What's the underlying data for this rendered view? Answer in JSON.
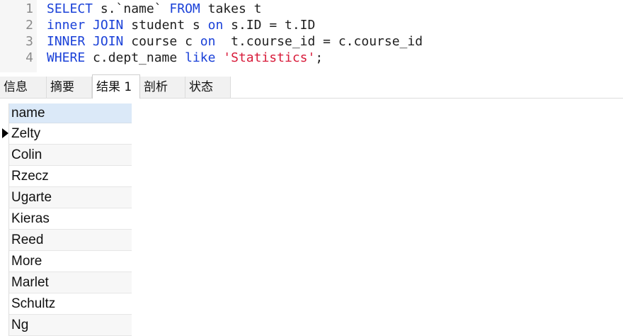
{
  "editor": {
    "lines": [
      {
        "num": "1",
        "tokens": [
          {
            "t": "SELECT",
            "k": "kw"
          },
          {
            "t": " s.`name` ",
            "k": ""
          },
          {
            "t": "FROM",
            "k": "kw"
          },
          {
            "t": " takes t",
            "k": ""
          }
        ]
      },
      {
        "num": "2",
        "tokens": [
          {
            "t": "inner",
            "k": "kw"
          },
          {
            "t": " ",
            "k": ""
          },
          {
            "t": "JOIN",
            "k": "kw"
          },
          {
            "t": " student s ",
            "k": ""
          },
          {
            "t": "on",
            "k": "kw"
          },
          {
            "t": " s.ID = t.ID",
            "k": ""
          }
        ]
      },
      {
        "num": "3",
        "tokens": [
          {
            "t": "INNER",
            "k": "kw"
          },
          {
            "t": " ",
            "k": ""
          },
          {
            "t": "JOIN",
            "k": "kw"
          },
          {
            "t": " course c ",
            "k": ""
          },
          {
            "t": "on",
            "k": "kw"
          },
          {
            "t": "  t.course_id = c.course_id",
            "k": ""
          }
        ]
      },
      {
        "num": "4",
        "tokens": [
          {
            "t": "WHERE",
            "k": "kw"
          },
          {
            "t": " c.dept_name ",
            "k": ""
          },
          {
            "t": "like",
            "k": "kw"
          },
          {
            "t": " ",
            "k": ""
          },
          {
            "t": "'Statistics'",
            "k": "str"
          },
          {
            "t": ";",
            "k": ""
          }
        ]
      }
    ]
  },
  "tabs": [
    {
      "label": "信息",
      "active": false
    },
    {
      "label": "摘要",
      "active": false
    },
    {
      "label": "结果 1",
      "active": true
    },
    {
      "label": "剖析",
      "active": false
    },
    {
      "label": "状态",
      "active": false
    }
  ],
  "result": {
    "column": "name",
    "rows": [
      "Zelty",
      "Colin",
      "Rzecz",
      "Ugarte",
      "Kieras",
      "Reed",
      "More",
      "Marlet",
      "Schultz",
      "Ng"
    ]
  },
  "colors": {
    "keyword": "#1a41d8",
    "string": "#d81b3a",
    "header_bg": "#dbe9f8"
  }
}
